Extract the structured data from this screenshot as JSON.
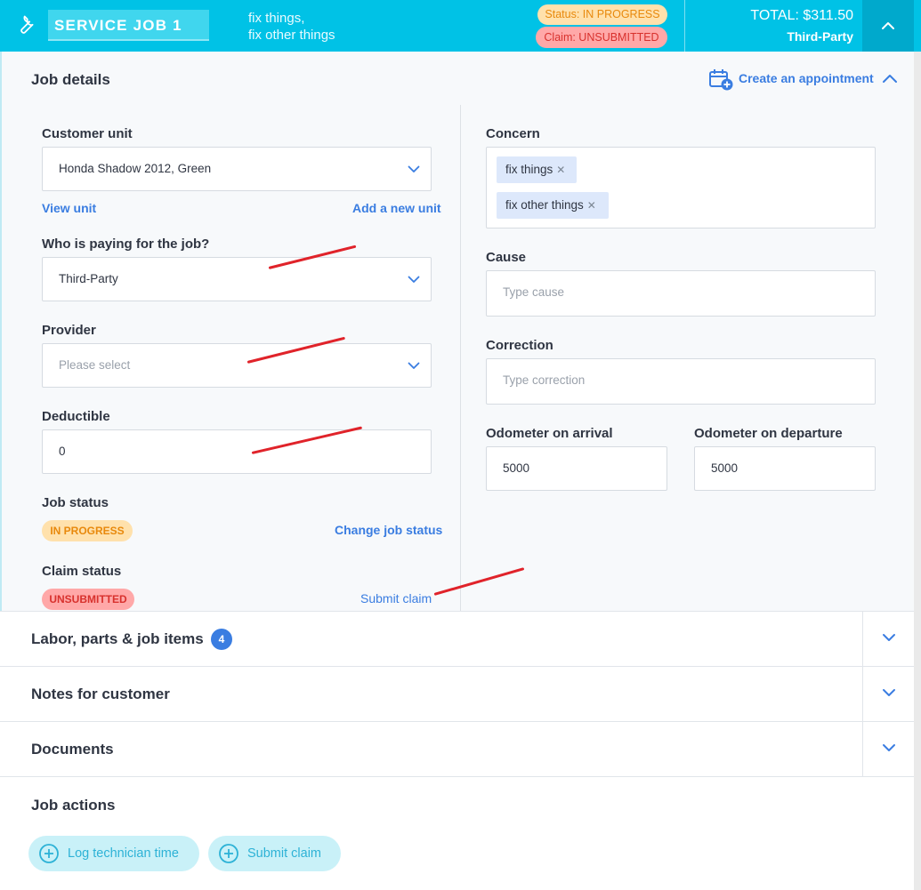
{
  "header": {
    "job_title": "SERVICE JOB 1",
    "description_line1": "fix things,",
    "description_line2": "fix other things",
    "status_pill": "Status: IN PROGRESS",
    "claim_pill": "Claim: UNSUBMITTED",
    "total": "TOTAL: $311.50",
    "payer": "Third-Party"
  },
  "job_details": {
    "title": "Job details",
    "create_appointment": "Create an appointment",
    "customer_unit": {
      "label": "Customer unit",
      "value": "Honda Shadow 2012, Green"
    },
    "view_unit": "View unit",
    "add_unit": "Add a new unit",
    "payer": {
      "label": "Who is paying for the job?",
      "value": "Third-Party"
    },
    "provider": {
      "label": "Provider",
      "placeholder": "Please select"
    },
    "deductible": {
      "label": "Deductible",
      "value": "0"
    },
    "job_status": {
      "label": "Job status",
      "badge": "IN PROGRESS",
      "link": "Change job status"
    },
    "claim_status": {
      "label": "Claim status",
      "badge": "UNSUBMITTED",
      "link": "Submit claim"
    },
    "concern": {
      "label": "Concern",
      "tags": [
        "fix things",
        "fix other things"
      ]
    },
    "cause": {
      "label": "Cause",
      "placeholder": "Type cause"
    },
    "correction": {
      "label": "Correction",
      "placeholder": "Type correction"
    },
    "odometer_arrival": {
      "label": "Odometer on arrival",
      "value": "5000"
    },
    "odometer_departure": {
      "label": "Odometer on departure",
      "value": "5000"
    }
  },
  "sections": {
    "labor": {
      "title": "Labor, parts & job items",
      "count": "4"
    },
    "notes": {
      "title": "Notes for customer"
    },
    "documents": {
      "title": "Documents"
    }
  },
  "job_actions": {
    "title": "Job actions",
    "log_time": "Log technician time",
    "submit_claim": "Submit claim"
  },
  "colors": {
    "header_bg": "#00c2e6",
    "accent_blue": "#3a7de1",
    "status_orange": "#e8890c",
    "claim_red": "#d8312d",
    "annotation_red": "#e0232a"
  }
}
